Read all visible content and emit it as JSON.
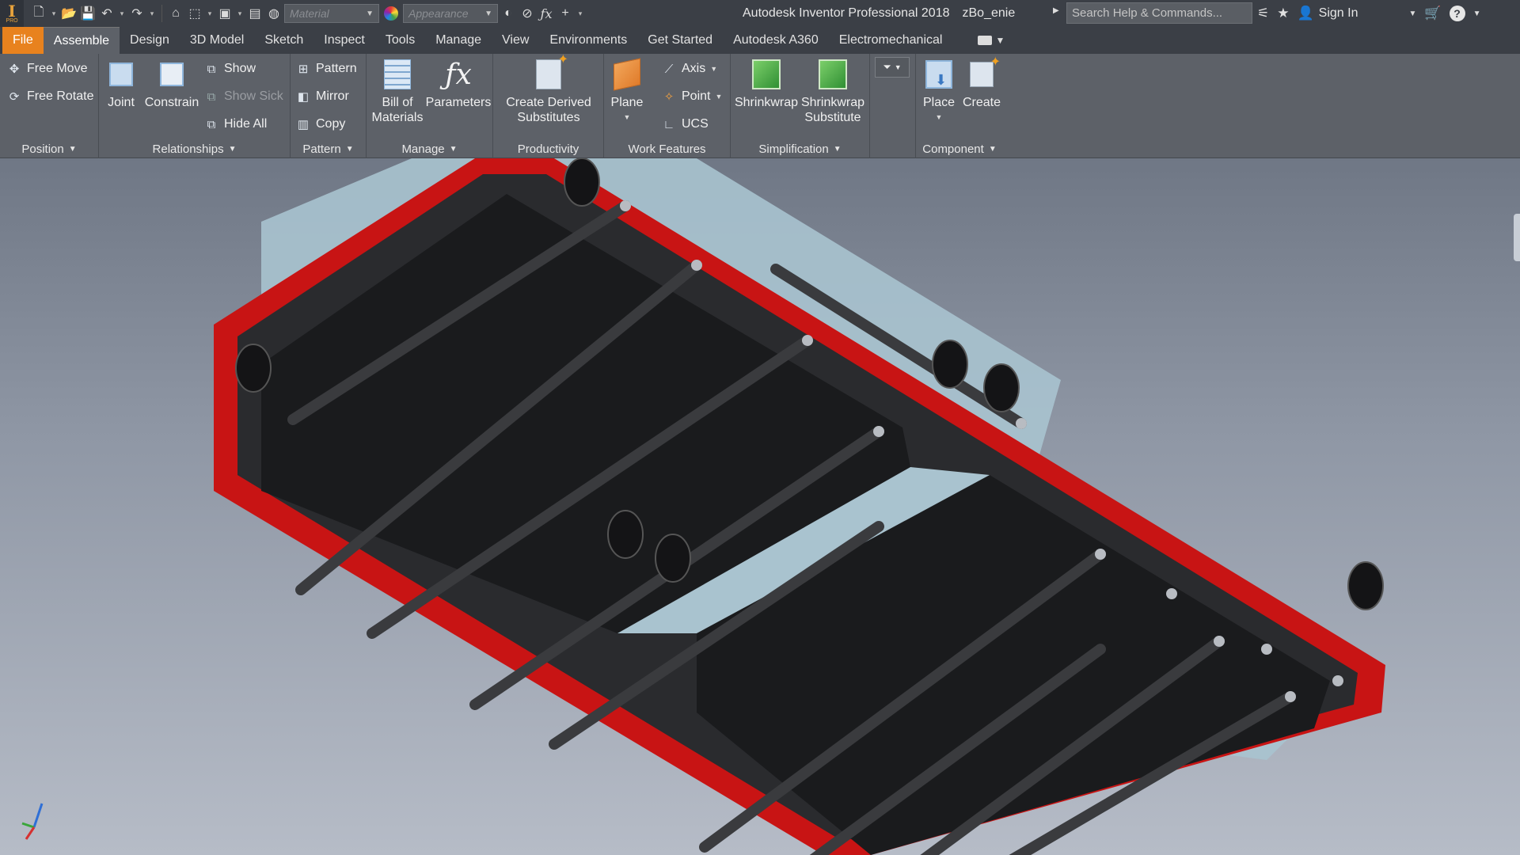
{
  "app": {
    "title": "Autodesk Inventor Professional 2018",
    "document": "zBo_enie",
    "logo_letter": "I",
    "logo_sub": "PRO"
  },
  "quick_access": {
    "material_placeholder": "Material",
    "appearance_placeholder": "Appearance"
  },
  "search": {
    "placeholder": "Search Help & Commands..."
  },
  "account": {
    "sign_in": "Sign In"
  },
  "tabs": [
    {
      "label": "File"
    },
    {
      "label": "Assemble"
    },
    {
      "label": "Design"
    },
    {
      "label": "3D Model"
    },
    {
      "label": "Sketch"
    },
    {
      "label": "Inspect"
    },
    {
      "label": "Tools"
    },
    {
      "label": "Manage"
    },
    {
      "label": "View"
    },
    {
      "label": "Environments"
    },
    {
      "label": "Get Started"
    },
    {
      "label": "Autodesk A360"
    },
    {
      "label": "Electromechanical"
    }
  ],
  "ribbon": {
    "position": {
      "label": "Position",
      "free_move": "Free Move",
      "free_rotate": "Free Rotate"
    },
    "relationships": {
      "label": "Relationships",
      "joint": "Joint",
      "constrain": "Constrain",
      "show": "Show",
      "show_sick": "Show Sick",
      "hide_all": "Hide All"
    },
    "pattern": {
      "label": "Pattern",
      "pattern": "Pattern",
      "mirror": "Mirror",
      "copy": "Copy"
    },
    "manage": {
      "label": "Manage",
      "bom_line1": "Bill of",
      "bom_line2": "Materials",
      "parameters": "Parameters"
    },
    "productivity": {
      "label": "Productivity",
      "line1": "Create Derived",
      "line2": "Substitutes"
    },
    "work_features": {
      "label": "Work Features",
      "plane": "Plane",
      "axis": "Axis",
      "point": "Point",
      "ucs": "UCS"
    },
    "simplification": {
      "label": "Simplification",
      "shrinkwrap": "Shrinkwrap",
      "sub_line1": "Shrinkwrap",
      "sub_line2": "Substitute"
    },
    "component": {
      "label": "Component",
      "place": "Place",
      "create": "Create"
    }
  },
  "colors": {
    "frame_red": "#c81414",
    "tray_black": "#1a1b1d",
    "shell_blue": "#a9c3cf",
    "file_tab": "#e8821e"
  }
}
